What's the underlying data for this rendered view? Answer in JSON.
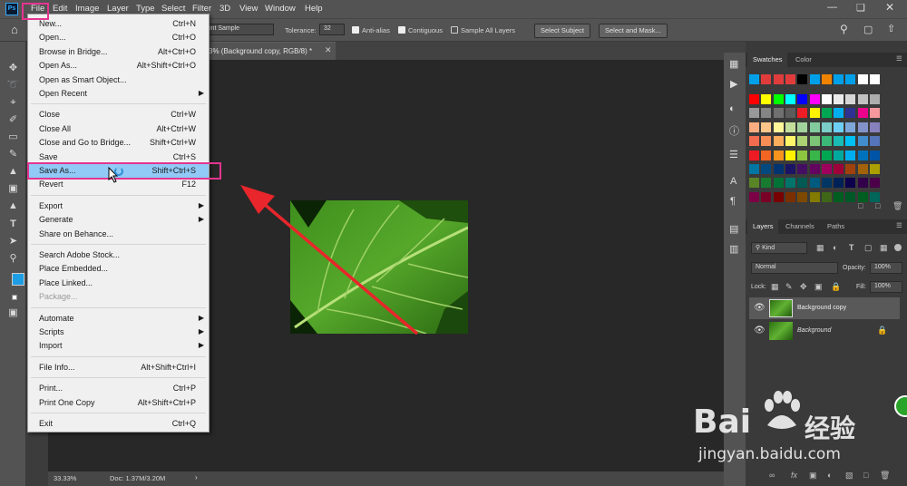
{
  "menubar": {
    "logo": "Ps",
    "items": [
      "File",
      "Edit",
      "Image",
      "Layer",
      "Type",
      "Select",
      "Filter",
      "3D",
      "View",
      "Window",
      "Help"
    ]
  },
  "options": {
    "sample_value": "int Sample",
    "tolerance_label": "Tolerance:",
    "tolerance_value": "32",
    "antialias_label": "Anti-alias",
    "contiguous_label": "Contiguous",
    "sample_all_label": "Sample All Layers",
    "select_subject": "Select Subject",
    "select_mask": "Select and Mask..."
  },
  "document": {
    "tab_title": "3% (Background copy, RGB/8) *",
    "zoom": "33.33%",
    "doc_info": "Doc: 1.37M/3.20M"
  },
  "file_menu": {
    "groups": [
      [
        {
          "label": "New...",
          "shortcut": "Ctrl+N"
        },
        {
          "label": "Open...",
          "shortcut": "Ctrl+O"
        },
        {
          "label": "Browse in Bridge...",
          "shortcut": "Alt+Ctrl+O"
        },
        {
          "label": "Open As...",
          "shortcut": "Alt+Shift+Ctrl+O"
        },
        {
          "label": "Open as Smart Object...",
          "shortcut": ""
        },
        {
          "label": "Open Recent",
          "shortcut": "",
          "submenu": true
        }
      ],
      [
        {
          "label": "Close",
          "shortcut": "Ctrl+W"
        },
        {
          "label": "Close All",
          "shortcut": "Alt+Ctrl+W"
        },
        {
          "label": "Close and Go to Bridge...",
          "shortcut": "Shift+Ctrl+W"
        },
        {
          "label": "Save",
          "shortcut": "Ctrl+S"
        },
        {
          "label": "Save As...",
          "shortcut": "Shift+Ctrl+S",
          "highlighted": true
        },
        {
          "label": "Revert",
          "shortcut": "F12"
        }
      ],
      [
        {
          "label": "Export",
          "shortcut": "",
          "submenu": true
        },
        {
          "label": "Generate",
          "shortcut": "",
          "submenu": true
        },
        {
          "label": "Share on Behance...",
          "shortcut": ""
        }
      ],
      [
        {
          "label": "Search Adobe Stock...",
          "shortcut": ""
        },
        {
          "label": "Place Embedded...",
          "shortcut": ""
        },
        {
          "label": "Place Linked...",
          "shortcut": ""
        },
        {
          "label": "Package...",
          "shortcut": "",
          "disabled": true
        }
      ],
      [
        {
          "label": "Automate",
          "shortcut": "",
          "submenu": true
        },
        {
          "label": "Scripts",
          "shortcut": "",
          "submenu": true
        },
        {
          "label": "Import",
          "shortcut": "",
          "submenu": true
        }
      ],
      [
        {
          "label": "File Info...",
          "shortcut": "Alt+Shift+Ctrl+I"
        }
      ],
      [
        {
          "label": "Print...",
          "shortcut": "Ctrl+P"
        },
        {
          "label": "Print One Copy",
          "shortcut": "Alt+Shift+Ctrl+P"
        }
      ],
      [
        {
          "label": "Exit",
          "shortcut": "Ctrl+Q"
        }
      ]
    ]
  },
  "swatches_panel": {
    "tabs": [
      "Swatches",
      "Color"
    ],
    "top_row": [
      "#00a0e9",
      "#e03c3c",
      "#e03c3c",
      "#e03c3c",
      "#000000",
      "#00a0e9",
      "#f08300",
      "#00a0e9",
      "#00a0e9",
      "#ffffff",
      "#ffffff"
    ],
    "grid": [
      [
        "#ff0000",
        "#ffff00",
        "#00ff00",
        "#00ffff",
        "#0000ff",
        "#ff00ff",
        "#ffffff",
        "#ebebeb",
        "#d6d6d6",
        "#c2c2c2",
        "#adadad"
      ],
      [
        "#999999",
        "#858585",
        "#707070",
        "#5c5c5c",
        "#ee1c24",
        "#fff200",
        "#00a651",
        "#00aeef",
        "#2e3192",
        "#ec008c",
        "#f6989d"
      ],
      [
        "#f9ad81",
        "#fdc68a",
        "#fff799",
        "#c4df9b",
        "#a3d39c",
        "#82ca9d",
        "#7bcdc8",
        "#6ecff6",
        "#7da7d9",
        "#8393ca",
        "#8781bd"
      ],
      [
        "#f26c4f",
        "#f68e56",
        "#fbaf5d",
        "#fff568",
        "#acd373",
        "#7cc576",
        "#3bb878",
        "#1abbb4",
        "#00bff3",
        "#438ccb",
        "#5674b9"
      ],
      [
        "#ed1c24",
        "#f26522",
        "#f7941d",
        "#fff200",
        "#8dc63f",
        "#39b54a",
        "#00a651",
        "#00a99d",
        "#00aeef",
        "#0072bc",
        "#0054a6"
      ],
      [
        "#0076a3",
        "#004a80",
        "#003471",
        "#1b1464",
        "#440e62",
        "#630460",
        "#9e005d",
        "#9e0039",
        "#a0410d",
        "#a3620a",
        "#aba000"
      ],
      [
        "#598527",
        "#197b30",
        "#007236",
        "#00746b",
        "#005952",
        "#005b7f",
        "#003663",
        "#002157",
        "#0d004c",
        "#32004b",
        "#4b0049"
      ],
      [
        "#7b0046",
        "#7a0026",
        "#790000",
        "#7b2e00",
        "#7d4900",
        "#827b00",
        "#406618",
        "#005e20",
        "#005826",
        "#005e20",
        "#00655b"
      ]
    ]
  },
  "layers_panel": {
    "tabs": [
      "Layers",
      "Channels",
      "Paths"
    ],
    "kind": "Kind",
    "blend_mode": "Normal",
    "opacity_label": "Opacity:",
    "opacity_value": "100%",
    "lock_label": "Lock:",
    "fill_label": "Fill:",
    "fill_value": "100%",
    "layers": [
      {
        "name": "Background copy",
        "selected": true
      },
      {
        "name": "Background",
        "locked": true
      }
    ]
  },
  "colors": {
    "accent_pink": "#e4348f",
    "menu_highlight": "#91c9f7",
    "arrow_red": "#e8262b",
    "foreground": "#1d9de3"
  }
}
